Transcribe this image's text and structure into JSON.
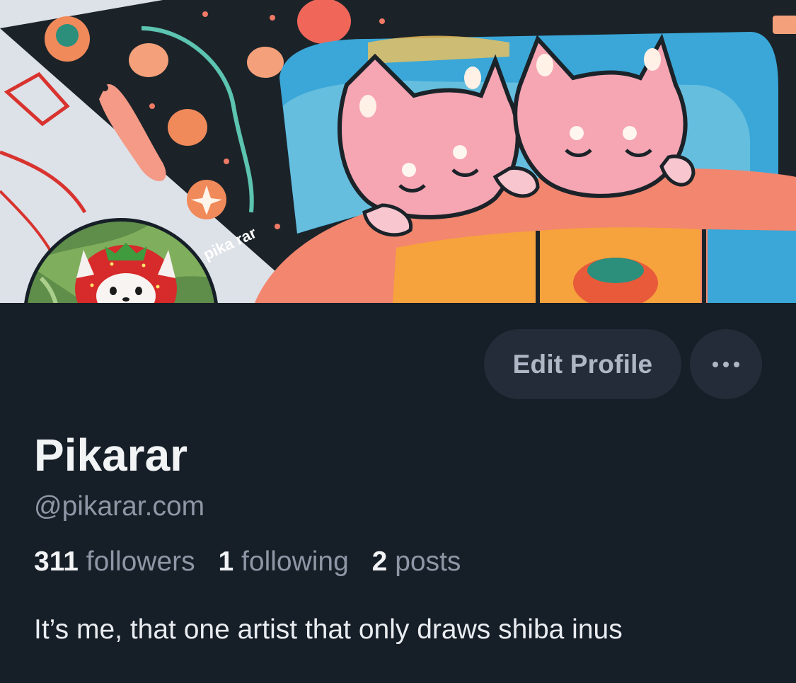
{
  "banner": {
    "signature_text": "pika rar",
    "description": "illustration"
  },
  "profile": {
    "display_name": "Pikarar",
    "handle": "@pikarar.com",
    "bio": "It’s me, that one artist that only draws shiba inus"
  },
  "actions": {
    "edit_label": "Edit Profile",
    "more_icon": "ellipsis-icon"
  },
  "stats": {
    "followers_count": "311",
    "followers_label": "followers",
    "following_count": "1",
    "following_label": "following",
    "posts_count": "2",
    "posts_label": "posts"
  },
  "colors": {
    "background": "#161e27",
    "button_bg": "#252c39",
    "text_primary": "#f1f3f5",
    "text_secondary": "#8f97a6"
  }
}
